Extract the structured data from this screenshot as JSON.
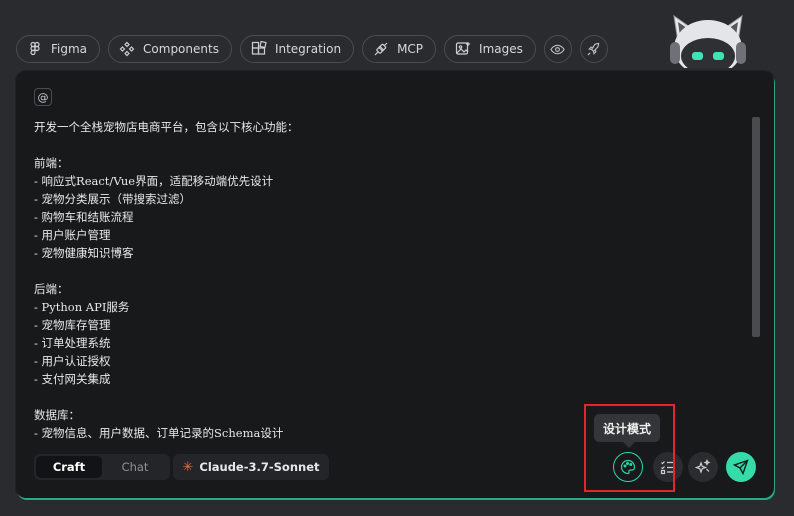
{
  "toolbar": {
    "items": [
      {
        "label": "Figma",
        "icon": "figma-icon"
      },
      {
        "label": "Components",
        "icon": "components-icon"
      },
      {
        "label": "Integration",
        "icon": "integration-icon"
      },
      {
        "label": "MCP",
        "icon": "mcp-plug-icon"
      },
      {
        "label": "Images",
        "icon": "image-icon"
      }
    ],
    "extra_icons": [
      "eye-icon",
      "rocket-icon"
    ]
  },
  "mascot": {
    "icon": "robot-cat-mascot-icon"
  },
  "editor": {
    "mention_symbol": "@",
    "lines": [
      "开发一个全栈宠物店电商平台，包含以下核心功能：",
      "",
      "前端：",
      "- 响应式React/Vue界面，适配移动端优先设计",
      "- 宠物分类展示（带搜索过滤）",
      "- 购物车和结账流程",
      "- 用户账户管理",
      "- 宠物健康知识博客",
      "",
      "后端：",
      "- Python API服务",
      "- 宠物库存管理",
      "- 订单处理系统",
      "- 用户认证授权",
      "- 支付网关集成",
      "",
      "数据库：",
      "- 宠物信息、用户数据、订单记录的Schema设计"
    ]
  },
  "mode": {
    "options": [
      "Craft",
      "Chat"
    ],
    "selected": "Craft"
  },
  "model": {
    "label": "Claude-3.7-Sonnet",
    "icon": "claude-spark-icon"
  },
  "actions": {
    "design_mode_icon": "palette-icon",
    "list_icon": "checklist-icon",
    "magic_icon": "sparkle-magic-icon",
    "send_icon": "send-icon"
  },
  "tooltip": {
    "text": "设计模式"
  },
  "colors": {
    "accent": "#35dcaa",
    "background": "#2a2b2e",
    "panel": "#18191b",
    "highlight_border": "#e0272a",
    "claude_spark": "#e0724b"
  }
}
